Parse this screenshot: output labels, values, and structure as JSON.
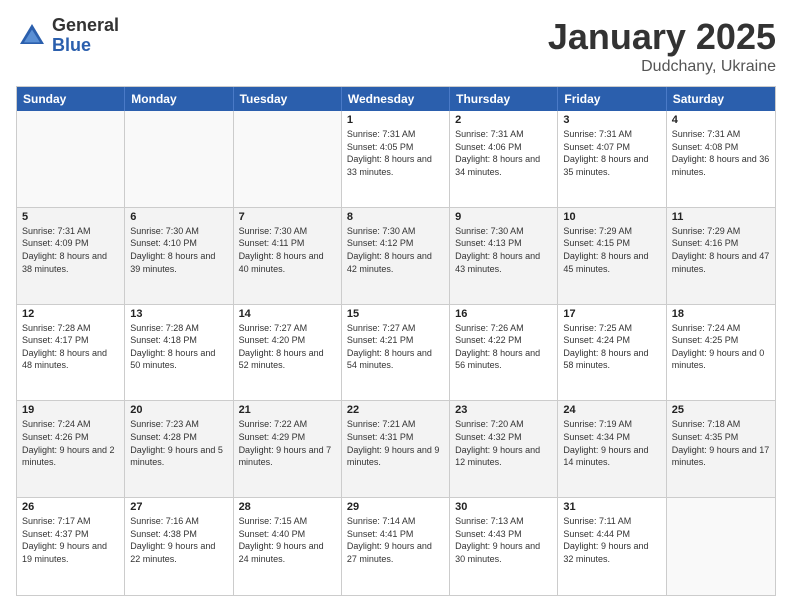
{
  "header": {
    "logo_general": "General",
    "logo_blue": "Blue",
    "month_title": "January 2025",
    "location": "Dudchany, Ukraine"
  },
  "days_of_week": [
    "Sunday",
    "Monday",
    "Tuesday",
    "Wednesday",
    "Thursday",
    "Friday",
    "Saturday"
  ],
  "weeks": [
    [
      {
        "day": "",
        "sunrise": "",
        "sunset": "",
        "daylight": "",
        "empty": true
      },
      {
        "day": "",
        "sunrise": "",
        "sunset": "",
        "daylight": "",
        "empty": true
      },
      {
        "day": "",
        "sunrise": "",
        "sunset": "",
        "daylight": "",
        "empty": true
      },
      {
        "day": "1",
        "sunrise": "Sunrise: 7:31 AM",
        "sunset": "Sunset: 4:05 PM",
        "daylight": "Daylight: 8 hours and 33 minutes."
      },
      {
        "day": "2",
        "sunrise": "Sunrise: 7:31 AM",
        "sunset": "Sunset: 4:06 PM",
        "daylight": "Daylight: 8 hours and 34 minutes."
      },
      {
        "day": "3",
        "sunrise": "Sunrise: 7:31 AM",
        "sunset": "Sunset: 4:07 PM",
        "daylight": "Daylight: 8 hours and 35 minutes."
      },
      {
        "day": "4",
        "sunrise": "Sunrise: 7:31 AM",
        "sunset": "Sunset: 4:08 PM",
        "daylight": "Daylight: 8 hours and 36 minutes."
      }
    ],
    [
      {
        "day": "5",
        "sunrise": "Sunrise: 7:31 AM",
        "sunset": "Sunset: 4:09 PM",
        "daylight": "Daylight: 8 hours and 38 minutes."
      },
      {
        "day": "6",
        "sunrise": "Sunrise: 7:30 AM",
        "sunset": "Sunset: 4:10 PM",
        "daylight": "Daylight: 8 hours and 39 minutes."
      },
      {
        "day": "7",
        "sunrise": "Sunrise: 7:30 AM",
        "sunset": "Sunset: 4:11 PM",
        "daylight": "Daylight: 8 hours and 40 minutes."
      },
      {
        "day": "8",
        "sunrise": "Sunrise: 7:30 AM",
        "sunset": "Sunset: 4:12 PM",
        "daylight": "Daylight: 8 hours and 42 minutes."
      },
      {
        "day": "9",
        "sunrise": "Sunrise: 7:30 AM",
        "sunset": "Sunset: 4:13 PM",
        "daylight": "Daylight: 8 hours and 43 minutes."
      },
      {
        "day": "10",
        "sunrise": "Sunrise: 7:29 AM",
        "sunset": "Sunset: 4:15 PM",
        "daylight": "Daylight: 8 hours and 45 minutes."
      },
      {
        "day": "11",
        "sunrise": "Sunrise: 7:29 AM",
        "sunset": "Sunset: 4:16 PM",
        "daylight": "Daylight: 8 hours and 47 minutes."
      }
    ],
    [
      {
        "day": "12",
        "sunrise": "Sunrise: 7:28 AM",
        "sunset": "Sunset: 4:17 PM",
        "daylight": "Daylight: 8 hours and 48 minutes."
      },
      {
        "day": "13",
        "sunrise": "Sunrise: 7:28 AM",
        "sunset": "Sunset: 4:18 PM",
        "daylight": "Daylight: 8 hours and 50 minutes."
      },
      {
        "day": "14",
        "sunrise": "Sunrise: 7:27 AM",
        "sunset": "Sunset: 4:20 PM",
        "daylight": "Daylight: 8 hours and 52 minutes."
      },
      {
        "day": "15",
        "sunrise": "Sunrise: 7:27 AM",
        "sunset": "Sunset: 4:21 PM",
        "daylight": "Daylight: 8 hours and 54 minutes."
      },
      {
        "day": "16",
        "sunrise": "Sunrise: 7:26 AM",
        "sunset": "Sunset: 4:22 PM",
        "daylight": "Daylight: 8 hours and 56 minutes."
      },
      {
        "day": "17",
        "sunrise": "Sunrise: 7:25 AM",
        "sunset": "Sunset: 4:24 PM",
        "daylight": "Daylight: 8 hours and 58 minutes."
      },
      {
        "day": "18",
        "sunrise": "Sunrise: 7:24 AM",
        "sunset": "Sunset: 4:25 PM",
        "daylight": "Daylight: 9 hours and 0 minutes."
      }
    ],
    [
      {
        "day": "19",
        "sunrise": "Sunrise: 7:24 AM",
        "sunset": "Sunset: 4:26 PM",
        "daylight": "Daylight: 9 hours and 2 minutes."
      },
      {
        "day": "20",
        "sunrise": "Sunrise: 7:23 AM",
        "sunset": "Sunset: 4:28 PM",
        "daylight": "Daylight: 9 hours and 5 minutes."
      },
      {
        "day": "21",
        "sunrise": "Sunrise: 7:22 AM",
        "sunset": "Sunset: 4:29 PM",
        "daylight": "Daylight: 9 hours and 7 minutes."
      },
      {
        "day": "22",
        "sunrise": "Sunrise: 7:21 AM",
        "sunset": "Sunset: 4:31 PM",
        "daylight": "Daylight: 9 hours and 9 minutes."
      },
      {
        "day": "23",
        "sunrise": "Sunrise: 7:20 AM",
        "sunset": "Sunset: 4:32 PM",
        "daylight": "Daylight: 9 hours and 12 minutes."
      },
      {
        "day": "24",
        "sunrise": "Sunrise: 7:19 AM",
        "sunset": "Sunset: 4:34 PM",
        "daylight": "Daylight: 9 hours and 14 minutes."
      },
      {
        "day": "25",
        "sunrise": "Sunrise: 7:18 AM",
        "sunset": "Sunset: 4:35 PM",
        "daylight": "Daylight: 9 hours and 17 minutes."
      }
    ],
    [
      {
        "day": "26",
        "sunrise": "Sunrise: 7:17 AM",
        "sunset": "Sunset: 4:37 PM",
        "daylight": "Daylight: 9 hours and 19 minutes."
      },
      {
        "day": "27",
        "sunrise": "Sunrise: 7:16 AM",
        "sunset": "Sunset: 4:38 PM",
        "daylight": "Daylight: 9 hours and 22 minutes."
      },
      {
        "day": "28",
        "sunrise": "Sunrise: 7:15 AM",
        "sunset": "Sunset: 4:40 PM",
        "daylight": "Daylight: 9 hours and 24 minutes."
      },
      {
        "day": "29",
        "sunrise": "Sunrise: 7:14 AM",
        "sunset": "Sunset: 4:41 PM",
        "daylight": "Daylight: 9 hours and 27 minutes."
      },
      {
        "day": "30",
        "sunrise": "Sunrise: 7:13 AM",
        "sunset": "Sunset: 4:43 PM",
        "daylight": "Daylight: 9 hours and 30 minutes."
      },
      {
        "day": "31",
        "sunrise": "Sunrise: 7:11 AM",
        "sunset": "Sunset: 4:44 PM",
        "daylight": "Daylight: 9 hours and 32 minutes."
      },
      {
        "day": "",
        "sunrise": "",
        "sunset": "",
        "daylight": "",
        "empty": true
      }
    ]
  ]
}
